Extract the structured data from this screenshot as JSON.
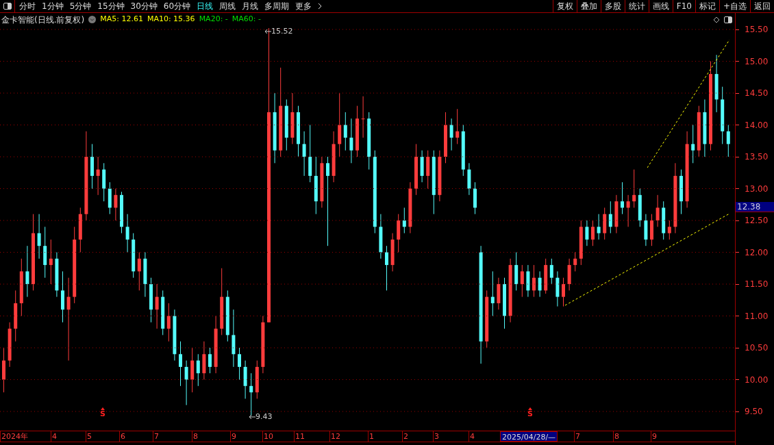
{
  "toolbar": {
    "periods": [
      {
        "label": "分时",
        "selected": false
      },
      {
        "label": "1分钟",
        "selected": false
      },
      {
        "label": "5分钟",
        "selected": false
      },
      {
        "label": "15分钟",
        "selected": false
      },
      {
        "label": "30分钟",
        "selected": false
      },
      {
        "label": "60分钟",
        "selected": false
      },
      {
        "label": "日线",
        "selected": true
      },
      {
        "label": "周线",
        "selected": false
      },
      {
        "label": "月线",
        "selected": false
      },
      {
        "label": "多周期",
        "selected": false
      },
      {
        "label": "更多",
        "selected": false
      }
    ],
    "actions": [
      "复权",
      "叠加",
      "多股",
      "统计",
      "画线",
      "F10",
      "标记",
      "+自选",
      "返回"
    ]
  },
  "info": {
    "title": "金卡智能(日线.前复权)",
    "ma": [
      {
        "label": "MA5: 12.61",
        "color": "#ffff00"
      },
      {
        "label": "MA10: 15.36",
        "color": "#ffff00"
      },
      {
        "label": "MA20: -",
        "color": "#00e000"
      },
      {
        "label": "MA60: -",
        "color": "#00e000"
      }
    ]
  },
  "chart": {
    "high_label": "15.52",
    "low_label": "9.43",
    "signals": [
      "S",
      "S"
    ],
    "chart_data": {
      "type": "candlestick",
      "ohlc": [
        [
          10.0,
          10.5,
          9.8,
          10.3
        ],
        [
          10.3,
          10.9,
          10.2,
          10.8
        ],
        [
          10.8,
          11.4,
          10.6,
          11.2
        ],
        [
          11.2,
          11.9,
          11.0,
          11.7
        ],
        [
          11.7,
          12.1,
          11.3,
          11.5
        ],
        [
          11.5,
          12.6,
          11.4,
          12.3
        ],
        [
          12.3,
          12.6,
          11.9,
          12.1
        ],
        [
          12.1,
          12.4,
          11.6,
          11.8
        ],
        [
          11.8,
          12.2,
          11.5,
          11.9
        ],
        [
          11.9,
          12.0,
          11.3,
          11.4
        ],
        [
          11.4,
          11.7,
          10.9,
          11.1
        ],
        [
          11.1,
          11.6,
          10.3,
          11.3
        ],
        [
          11.3,
          12.4,
          11.2,
          12.2
        ],
        [
          12.2,
          12.7,
          12.0,
          12.6
        ],
        [
          12.6,
          13.9,
          12.5,
          13.5
        ],
        [
          13.5,
          13.7,
          13.0,
          13.2
        ],
        [
          13.2,
          13.5,
          12.9,
          13.3
        ],
        [
          13.3,
          13.4,
          12.8,
          13.0
        ],
        [
          13.0,
          13.1,
          12.6,
          12.7
        ],
        [
          12.7,
          13.0,
          12.5,
          12.9
        ],
        [
          12.9,
          12.95,
          12.3,
          12.4
        ],
        [
          12.4,
          12.6,
          12.0,
          12.2
        ],
        [
          12.2,
          12.3,
          11.6,
          11.7
        ],
        [
          11.7,
          12.0,
          11.4,
          11.9
        ],
        [
          11.9,
          12.0,
          11.3,
          11.5
        ],
        [
          11.5,
          11.6,
          10.9,
          11.1
        ],
        [
          11.1,
          11.5,
          10.8,
          11.3
        ],
        [
          11.3,
          11.4,
          10.7,
          10.8
        ],
        [
          10.8,
          11.2,
          10.6,
          11.0
        ],
        [
          11.0,
          11.1,
          10.3,
          10.4
        ],
        [
          10.4,
          10.6,
          9.9,
          10.2
        ],
        [
          10.2,
          10.3,
          9.6,
          10.0
        ],
        [
          10.0,
          10.5,
          9.8,
          10.3
        ],
        [
          10.3,
          10.4,
          9.9,
          10.1
        ],
        [
          10.1,
          10.6,
          10.0,
          10.4
        ],
        [
          10.4,
          10.5,
          10.1,
          10.2
        ],
        [
          10.2,
          11.0,
          10.1,
          10.8
        ],
        [
          10.8,
          11.75,
          10.7,
          11.3
        ],
        [
          11.3,
          11.4,
          10.6,
          10.7
        ],
        [
          10.7,
          11.1,
          10.2,
          10.4
        ],
        [
          10.4,
          10.5,
          10.0,
          10.2
        ],
        [
          10.2,
          10.3,
          9.7,
          9.9
        ],
        [
          9.9,
          10.1,
          9.43,
          9.8
        ],
        [
          9.8,
          10.3,
          9.7,
          10.2
        ],
        [
          10.2,
          11.0,
          10.1,
          10.9
        ],
        [
          10.9,
          15.52,
          10.9,
          14.2
        ],
        [
          14.2,
          14.5,
          13.4,
          13.6
        ],
        [
          13.6,
          14.9,
          13.5,
          14.3
        ],
        [
          14.3,
          14.4,
          13.6,
          13.8
        ],
        [
          13.8,
          14.5,
          13.7,
          14.2
        ],
        [
          14.2,
          14.3,
          13.5,
          13.7
        ],
        [
          13.7,
          13.9,
          13.2,
          13.5
        ],
        [
          13.5,
          14.0,
          13.1,
          13.2
        ],
        [
          13.2,
          13.5,
          12.6,
          12.8
        ],
        [
          12.8,
          13.5,
          12.7,
          13.4
        ],
        [
          13.4,
          13.5,
          12.1,
          13.2
        ],
        [
          13.2,
          13.9,
          13.1,
          13.7
        ],
        [
          13.7,
          14.5,
          13.5,
          14.0
        ],
        [
          14.0,
          14.2,
          13.6,
          13.8
        ],
        [
          13.8,
          14.1,
          13.4,
          13.6
        ],
        [
          13.6,
          14.3,
          13.5,
          14.1
        ],
        [
          14.1,
          14.45,
          13.8,
          14.1
        ],
        [
          14.1,
          14.2,
          13.3,
          13.5
        ],
        [
          13.5,
          13.6,
          12.3,
          12.4
        ],
        [
          12.4,
          12.6,
          11.9,
          12.0
        ],
        [
          12.0,
          12.1,
          11.4,
          11.8
        ],
        [
          11.8,
          12.3,
          11.7,
          12.2
        ],
        [
          12.2,
          12.6,
          12.0,
          12.5
        ],
        [
          12.5,
          12.7,
          12.3,
          12.4
        ],
        [
          12.4,
          13.1,
          12.3,
          13.0
        ],
        [
          13.0,
          13.7,
          12.9,
          13.5
        ],
        [
          13.5,
          13.6,
          13.1,
          13.2
        ],
        [
          13.2,
          13.6,
          13.0,
          13.5
        ],
        [
          13.5,
          13.6,
          12.6,
          12.9
        ],
        [
          12.9,
          13.6,
          12.8,
          13.5
        ],
        [
          13.5,
          14.2,
          13.4,
          14.0
        ],
        [
          14.0,
          14.1,
          13.6,
          13.8
        ],
        [
          13.8,
          14.25,
          13.7,
          13.9
        ],
        [
          13.9,
          14.0,
          13.2,
          13.3
        ],
        [
          13.3,
          13.4,
          12.9,
          13.0
        ],
        [
          13.0,
          13.1,
          12.6,
          12.7
        ],
        [
          12.0,
          12.1,
          10.25,
          10.6
        ],
        [
          10.6,
          11.4,
          10.5,
          11.3
        ],
        [
          11.3,
          11.7,
          11.0,
          11.2
        ],
        [
          11.2,
          11.6,
          11.1,
          11.5
        ],
        [
          11.5,
          11.6,
          10.8,
          11.0
        ],
        [
          11.0,
          11.9,
          10.9,
          11.8
        ],
        [
          11.8,
          12.0,
          11.4,
          11.5
        ],
        [
          11.5,
          11.8,
          11.3,
          11.7
        ],
        [
          11.7,
          11.8,
          11.3,
          11.4
        ],
        [
          11.4,
          11.8,
          11.3,
          11.6
        ],
        [
          11.6,
          11.7,
          11.3,
          11.4
        ],
        [
          11.4,
          11.9,
          11.35,
          11.8
        ],
        [
          11.8,
          11.9,
          11.5,
          11.6
        ],
        [
          11.6,
          11.7,
          11.15,
          11.3
        ],
        [
          11.3,
          11.6,
          11.15,
          11.5
        ],
        [
          11.5,
          11.9,
          11.4,
          11.8
        ],
        [
          11.8,
          12.0,
          11.7,
          11.9
        ],
        [
          11.9,
          12.5,
          11.8,
          12.4
        ],
        [
          12.4,
          12.5,
          12.1,
          12.2
        ],
        [
          12.2,
          12.5,
          12.1,
          12.4
        ],
        [
          12.4,
          12.6,
          12.2,
          12.3
        ],
        [
          12.3,
          12.7,
          12.2,
          12.6
        ],
        [
          12.6,
          12.8,
          12.3,
          12.4
        ],
        [
          12.4,
          12.9,
          12.3,
          12.8
        ],
        [
          12.8,
          13.1,
          12.6,
          12.7
        ],
        [
          12.7,
          12.9,
          12.4,
          12.8
        ],
        [
          12.8,
          13.3,
          12.7,
          12.9
        ],
        [
          12.9,
          13.0,
          12.4,
          12.5
        ],
        [
          12.5,
          12.6,
          12.1,
          12.2
        ],
        [
          12.2,
          12.6,
          12.1,
          12.5
        ],
        [
          12.5,
          12.9,
          12.4,
          12.7
        ],
        [
          12.7,
          12.8,
          12.2,
          12.3
        ],
        [
          12.3,
          12.5,
          12.2,
          12.4
        ],
        [
          12.4,
          13.4,
          12.3,
          13.2
        ],
        [
          13.2,
          13.3,
          12.6,
          12.8
        ],
        [
          12.8,
          13.9,
          12.7,
          13.7
        ],
        [
          13.7,
          14.0,
          13.4,
          13.6
        ],
        [
          13.6,
          14.3,
          13.5,
          14.2
        ],
        [
          14.2,
          14.4,
          13.5,
          13.7
        ],
        [
          13.7,
          15.0,
          13.6,
          14.8
        ],
        [
          14.8,
          15.1,
          14.2,
          14.4
        ],
        [
          14.4,
          14.6,
          13.7,
          13.9
        ],
        [
          13.9,
          14.0,
          13.5,
          13.7
        ]
      ]
    }
  },
  "y_axis": {
    "labels": [
      "15.50",
      "15.00",
      "14.50",
      "14.00",
      "13.50",
      "13.00",
      "12.50",
      "12.00",
      "11.50",
      "11.00",
      "10.50",
      "10.00",
      "9.50"
    ],
    "price_tag": "12.38"
  },
  "x_axis": {
    "labels": [
      {
        "label": "2024年",
        "kind": "tick"
      },
      {
        "label": "4",
        "kind": "tick"
      },
      {
        "label": "5",
        "kind": "tick"
      },
      {
        "label": "6",
        "kind": "tick"
      },
      {
        "label": "7",
        "kind": "tick"
      },
      {
        "label": "8",
        "kind": "tick"
      },
      {
        "label": "9",
        "kind": "tick"
      },
      {
        "label": "10",
        "kind": "tick"
      },
      {
        "label": "11",
        "kind": "tick"
      },
      {
        "label": "12",
        "kind": "tick"
      },
      {
        "label": "1",
        "kind": "tick"
      },
      {
        "label": "2",
        "kind": "tick"
      },
      {
        "label": "3",
        "kind": "tick"
      },
      {
        "label": "4",
        "kind": "tick"
      },
      {
        "label": "2025/04/28/—",
        "kind": "cursor"
      },
      {
        "label": "7",
        "kind": "tick"
      },
      {
        "label": "8",
        "kind": "tick"
      },
      {
        "label": "9",
        "kind": "tick"
      }
    ]
  }
}
